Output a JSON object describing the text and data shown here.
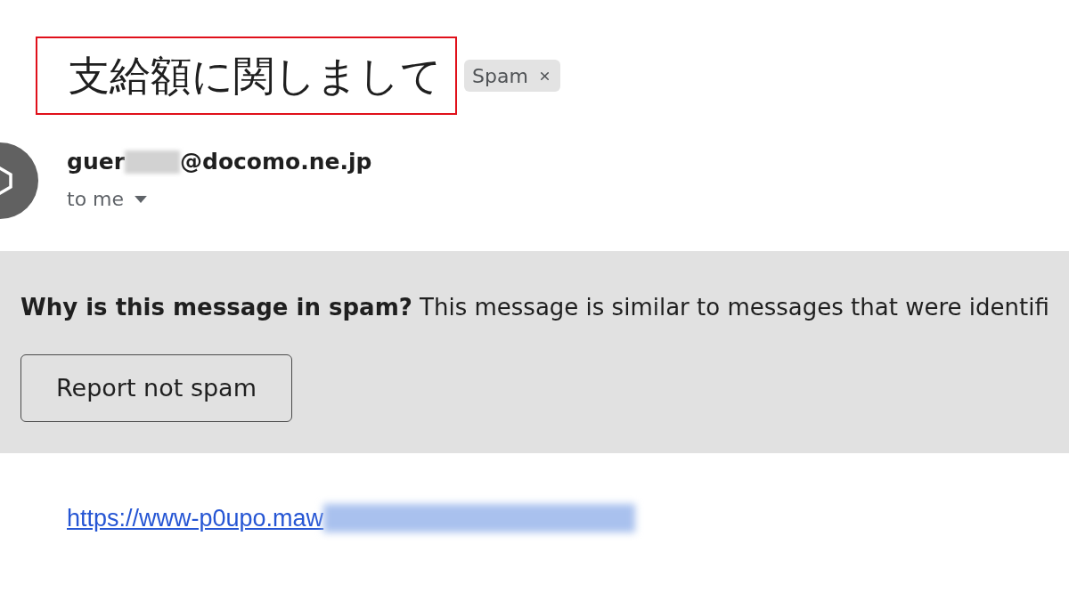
{
  "message": {
    "subject": {
      "text": "支給額に関しまして",
      "highlighted": true
    },
    "labels": [
      {
        "text": "Spam",
        "removable": true
      }
    ],
    "sender": {
      "address_start": "guer",
      "redacted": true,
      "address_end": "@docomo.ne.jp"
    },
    "recipients": {
      "text": "to me",
      "expanded": false
    },
    "spam_banner": {
      "text": "**Why is this message in spam?** This message is similar to messages that were identifi",
      "button": "Report not spam"
    },
    "body": {
      "link": {
        "text": "https://www-p0upo.maw",
        "redacted": true
      }
    }
  }
}
